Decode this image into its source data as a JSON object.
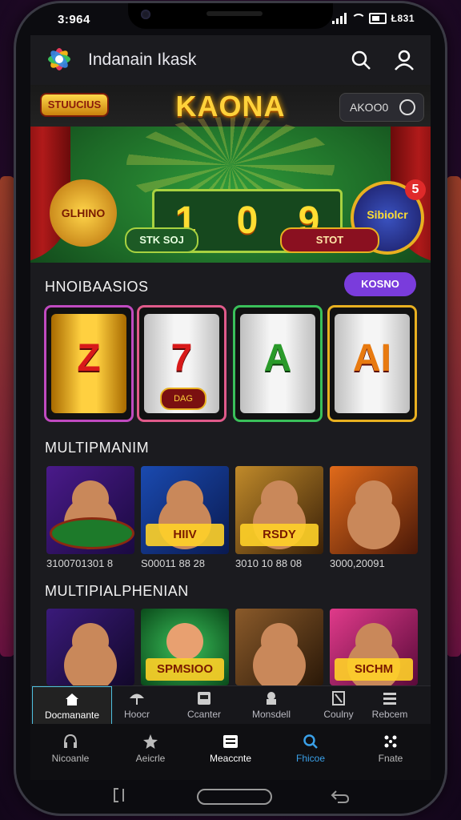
{
  "status_bar": {
    "time": "3:964",
    "right_label": "Ł831"
  },
  "app": {
    "title": "Indanain Ikask"
  },
  "banner": {
    "left_badge": "STUUCIUS",
    "title": "KAONA",
    "balance": "AKOO0",
    "digits": [
      "1",
      "0",
      "9"
    ],
    "left_emblem": "GLHINO",
    "right_emblem": "Sibiolcr",
    "right_emblem_badge": "5",
    "left_button": "STK SOJ",
    "right_button": "STOT"
  },
  "section_slots": {
    "title": "HNOIBAASIOS",
    "pill": "KOSNO",
    "slots": [
      {
        "symbol": "Z",
        "sub": ""
      },
      {
        "symbol": "7",
        "sub": "DAG"
      },
      {
        "symbol": "A",
        "sub": ""
      },
      {
        "symbol": "AI",
        "sub": ""
      }
    ]
  },
  "section_multi": {
    "title": "MULTIPMANIM",
    "tiles": [
      {
        "label": "",
        "caption": "3100701301 8"
      },
      {
        "label": "HIIV",
        "caption": "S00011 88 28"
      },
      {
        "label": "RSDY",
        "caption": "3010 10 88 08"
      },
      {
        "label": "",
        "caption": "3000,20091"
      }
    ]
  },
  "section_multi2": {
    "title": "MULTIPIALPHENIAN",
    "tiles": [
      {
        "label": ""
      },
      {
        "label": "SPMSIOO"
      },
      {
        "label": ""
      },
      {
        "label": "SICHM"
      }
    ]
  },
  "tabs": [
    {
      "label": "Docmanante",
      "icon": "home-icon",
      "active": true
    },
    {
      "label": "Hoocr",
      "icon": "umbrella-icon",
      "active": false
    },
    {
      "label": "Ccanter",
      "icon": "slot-icon",
      "active": false
    },
    {
      "label": "Monsdell",
      "icon": "chef-icon",
      "active": false
    },
    {
      "label": "Coulny",
      "icon": "book-icon",
      "active": false
    },
    {
      "label": "Rebcem",
      "icon": "list-icon",
      "active": false
    }
  ],
  "bottom_nav": [
    {
      "label": "Nicoanle",
      "icon": "headset-icon",
      "active": false
    },
    {
      "label": "Aeicrle",
      "icon": "star-icon",
      "active": false
    },
    {
      "label": "Meaccnte",
      "icon": "menu-icon",
      "active": false
    },
    {
      "label": "Fhicoe",
      "icon": "search-icon",
      "active": true
    },
    {
      "label": "Fnate",
      "icon": "grid-icon",
      "active": false
    }
  ],
  "colors": {
    "accent_purple": "#7a3cdc",
    "accent_blue": "#3aa0e8",
    "gold": "#ffd23a",
    "green": "#2f9a3a"
  }
}
